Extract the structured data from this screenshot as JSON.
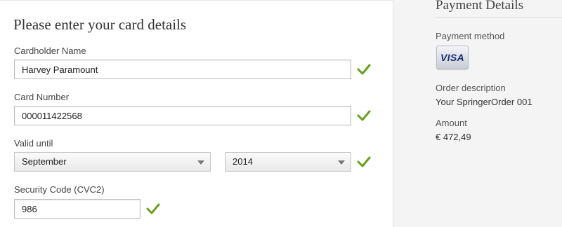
{
  "form": {
    "title": "Please enter your card details",
    "cardholder_label": "Cardholder Name",
    "cardholder_value": "Harvey Paramount",
    "card_number_label": "Card Number",
    "card_number_value": "000011422568",
    "valid_until_label": "Valid until",
    "month_value": "September",
    "year_value": "2014",
    "security_code_label": "Security Code (CVC2)",
    "security_code_value": "986"
  },
  "sidebar": {
    "title": "Payment Details",
    "payment_method_label": "Payment method",
    "payment_method_brand": "VISA",
    "order_description_label": "Order description",
    "order_description_value": "Your SpringerOrder 001",
    "amount_label": "Amount",
    "amount_value": "€ 472,49"
  },
  "colors": {
    "check": "#6a9e1f",
    "visa_text": "#1a2f7a"
  },
  "icons": {
    "validation": "check-icon",
    "dropdown": "chevron-down-icon"
  }
}
